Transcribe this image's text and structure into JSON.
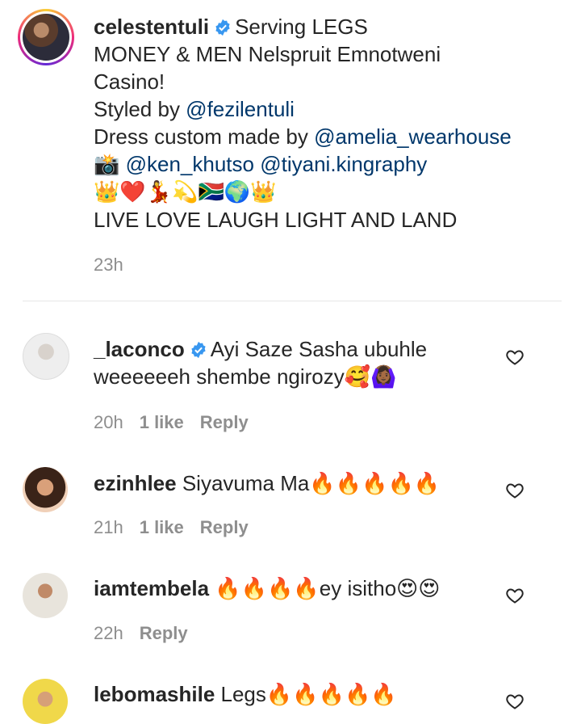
{
  "caption": {
    "username": "celestentuli",
    "text_1": "Serving LEGS",
    "line_2": "MONEY & MEN Nelspruit Emnotweni",
    "line_3": "Casino!",
    "styled_prefix": "Styled by ",
    "styled_link": "@fezilentuli",
    "dress_prefix": "Dress custom made by ",
    "dress_link": "@amelia_wearhouse",
    "camera_emoji": "📸",
    "photo_link_1": "@ken_khutso",
    "photo_link_2": "@tiyani.kingraphy",
    "emoji_line": "👑❤️💃💫🇿🇦🌍👑",
    "last_line": "LIVE LOVE LAUGH LIGHT AND LAND",
    "time": "23h"
  },
  "comments": [
    {
      "username": "_laconco",
      "verified": true,
      "text": "Ayi Saze Sasha ubuhle weeeeeeh shembe ngirozy🥰🙆🏾‍♀️",
      "time": "20h",
      "likes": "1 like",
      "reply": "Reply"
    },
    {
      "username": "ezinhlee",
      "verified": false,
      "text": "Siyavuma Ma🔥🔥🔥🔥🔥",
      "time": "21h",
      "likes": "1 like",
      "reply": "Reply"
    },
    {
      "username": "iamtembela",
      "verified": false,
      "text": "🔥🔥🔥🔥ey isitho😍😍",
      "time": "22h",
      "likes": "",
      "reply": "Reply"
    },
    {
      "username": "lebomashile",
      "verified": false,
      "text": "Legs🔥🔥🔥🔥🔥",
      "time": "",
      "likes": "",
      "reply": ""
    }
  ],
  "icons": {
    "verified": "verified-badge-icon",
    "like": "heart-outline-icon"
  },
  "colors": {
    "link": "#00376b",
    "verified": "#3897f0",
    "meta": "#8e8e8e"
  }
}
